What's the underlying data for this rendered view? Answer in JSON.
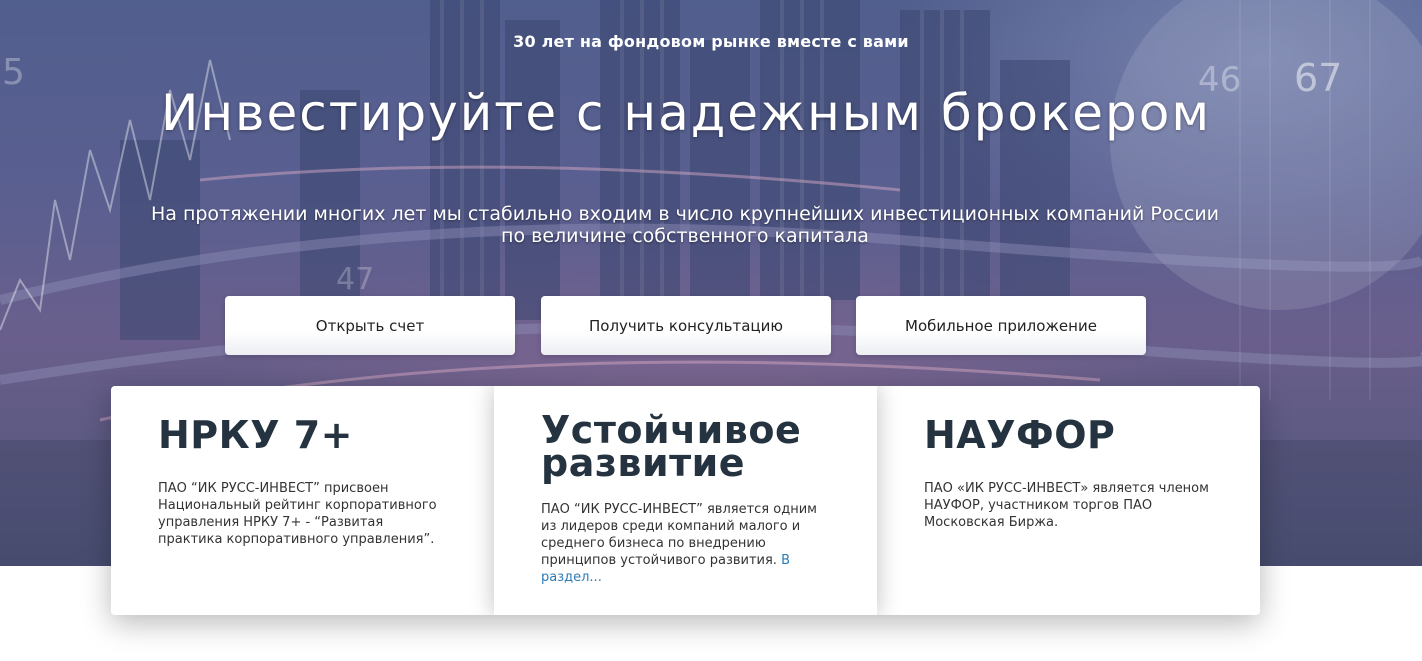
{
  "hero": {
    "tagline": "30 лет на фондовом рынке вместе с вами",
    "headline": "Инвестируйте с надежным брокером",
    "subline_1": "На протяжении многих лет мы стабильно входим в число крупнейших инвестиционных компаний России",
    "subline_2": "по величине собственного капитала",
    "bg_numbers": [
      "5",
      "46",
      "67",
      "47"
    ]
  },
  "buttons": {
    "open_account": "Открыть счет",
    "consult": "Получить консультацию",
    "mobile_app": "Мобильное приложение"
  },
  "cards": [
    {
      "title_1": "НРКУ 7+",
      "text": "ПАО “ИК РУСС-ИНВЕСТ” присвоен Национальный рейтинг корпоративного управления НРКУ 7+ - “Развитая практика корпоративного управления”."
    },
    {
      "title_1": "Устойчивое",
      "title_2": "развитие",
      "text": "ПАО “ИК РУСС-ИНВЕСТ” является одним из лидеров среди компаний малого и среднего бизнеса по внедрению принципов устойчивого развития.",
      "link": "В раздел..."
    },
    {
      "title_1": "НАУФОР",
      "text": "ПАО «ИК РУСС-ИНВЕСТ» является членом НАУФОР, участником торгов ПАО Московская Биржа."
    }
  ],
  "colors": {
    "title": "#24333f",
    "link": "#2c7bb6",
    "hero_bg": "#5a5f90"
  }
}
